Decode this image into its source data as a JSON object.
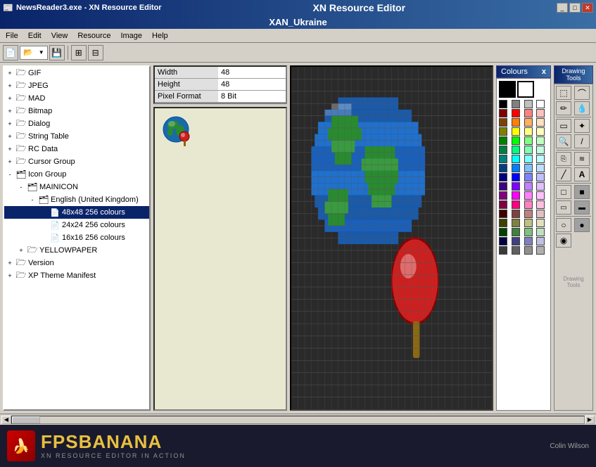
{
  "titlebar": {
    "app_name": "NewsReader3.exe - XN Resource Editor",
    "title": "XN Resource Editor",
    "subtitle": "XAN_Ukraine",
    "controls": [
      "minimize",
      "maximize",
      "close"
    ]
  },
  "menu": {
    "items": [
      "File",
      "Edit",
      "View",
      "Resource",
      "Image",
      "Help"
    ]
  },
  "toolbar": {
    "buttons": [
      "new",
      "open",
      "save",
      "dropdown",
      "separator",
      "tree1",
      "tree2"
    ]
  },
  "properties": {
    "width_label": "Width",
    "width_value": "48",
    "height_label": "Height",
    "height_value": "48",
    "pixel_format_label": "Pixel Format",
    "pixel_format_value": "8 Bit"
  },
  "tree": {
    "items": [
      {
        "label": "GIF",
        "indent": 0,
        "type": "folder",
        "expanded": false
      },
      {
        "label": "JPEG",
        "indent": 0,
        "type": "folder",
        "expanded": false
      },
      {
        "label": "MAD",
        "indent": 0,
        "type": "folder",
        "expanded": false
      },
      {
        "label": "Bitmap",
        "indent": 0,
        "type": "folder",
        "expanded": false
      },
      {
        "label": "Dialog",
        "indent": 0,
        "type": "folder",
        "expanded": false
      },
      {
        "label": "String Table",
        "indent": 0,
        "type": "folder",
        "expanded": false
      },
      {
        "label": "RC Data",
        "indent": 0,
        "type": "folder",
        "expanded": false
      },
      {
        "label": "Cursor Group",
        "indent": 0,
        "type": "folder",
        "expanded": false
      },
      {
        "label": "Icon Group",
        "indent": 0,
        "type": "folder",
        "expanded": true
      },
      {
        "label": "MAINICON",
        "indent": 1,
        "type": "folder",
        "expanded": true
      },
      {
        "label": "English (United Kingdom)",
        "indent": 2,
        "type": "folder",
        "expanded": true
      },
      {
        "label": "48x48 256 colours",
        "indent": 3,
        "type": "file"
      },
      {
        "label": "24x24 256 colours",
        "indent": 3,
        "type": "file"
      },
      {
        "label": "16x16 256 colours",
        "indent": 3,
        "type": "file"
      },
      {
        "label": "YELLOWPAPER",
        "indent": 1,
        "type": "folder",
        "expanded": false
      },
      {
        "label": "Version",
        "indent": 0,
        "type": "folder",
        "expanded": false
      },
      {
        "label": "XP Theme Manifest",
        "indent": 0,
        "type": "folder",
        "expanded": false
      }
    ]
  },
  "colours": {
    "title": "Colours",
    "close_label": "x",
    "primary_color": "#000000",
    "secondary_color": "#ffffff",
    "swatches": [
      [
        "#000000",
        "#808080"
      ],
      [
        "#ffffff",
        "#c0c0c0"
      ],
      [
        "#800000",
        "#ff0000"
      ],
      [
        "#808000",
        "#ffff00"
      ],
      [
        "#008000",
        "#00ff00"
      ],
      [
        "#008080",
        "#00ffff"
      ],
      [
        "#000080",
        "#0000ff"
      ],
      [
        "#800080",
        "#ff00ff"
      ],
      [
        "#804000",
        "#ff8040"
      ],
      [
        "#004080",
        "#0080ff"
      ],
      [
        "#408080",
        "#80ffff"
      ],
      [
        "#400040",
        "#ff40ff"
      ],
      [
        "#804040",
        "#ff8080"
      ],
      [
        "#408040",
        "#80ff80"
      ],
      [
        "#004040",
        "#008080"
      ],
      [
        "#4040ff",
        "#8080ff"
      ]
    ]
  },
  "drawing_tools": {
    "title": "Drawing Tools",
    "tools": [
      {
        "name": "dotted-rect",
        "icon": "⬚"
      },
      {
        "name": "lasso",
        "icon": "⌒"
      },
      {
        "name": "pencil",
        "icon": "✏"
      },
      {
        "name": "eyedropper",
        "icon": "💧"
      },
      {
        "name": "eraser",
        "icon": "▭"
      },
      {
        "name": "magic-wand",
        "icon": "✦"
      },
      {
        "name": "zoom",
        "icon": "🔍"
      },
      {
        "name": "brush",
        "icon": "/"
      },
      {
        "name": "clone",
        "icon": "⎘"
      },
      {
        "name": "airbrush",
        "icon": "≋"
      },
      {
        "name": "line",
        "icon": "╱"
      },
      {
        "name": "text",
        "icon": "A"
      },
      {
        "name": "rect-outline",
        "icon": "□"
      },
      {
        "name": "rounded-rect",
        "icon": "▭"
      },
      {
        "name": "rounded-filled",
        "icon": "▬"
      },
      {
        "name": "ellipse-outline",
        "icon": "○"
      },
      {
        "name": "ellipse-filled",
        "icon": "●"
      },
      {
        "name": "ellipse-3",
        "icon": "◉"
      }
    ]
  },
  "footer": {
    "logo": "FPSBANANA",
    "tagline": "XN RESOURCE EDITOR IN ACTION",
    "author": "Colin Wilson"
  },
  "status": {
    "scroll_position": 0
  }
}
